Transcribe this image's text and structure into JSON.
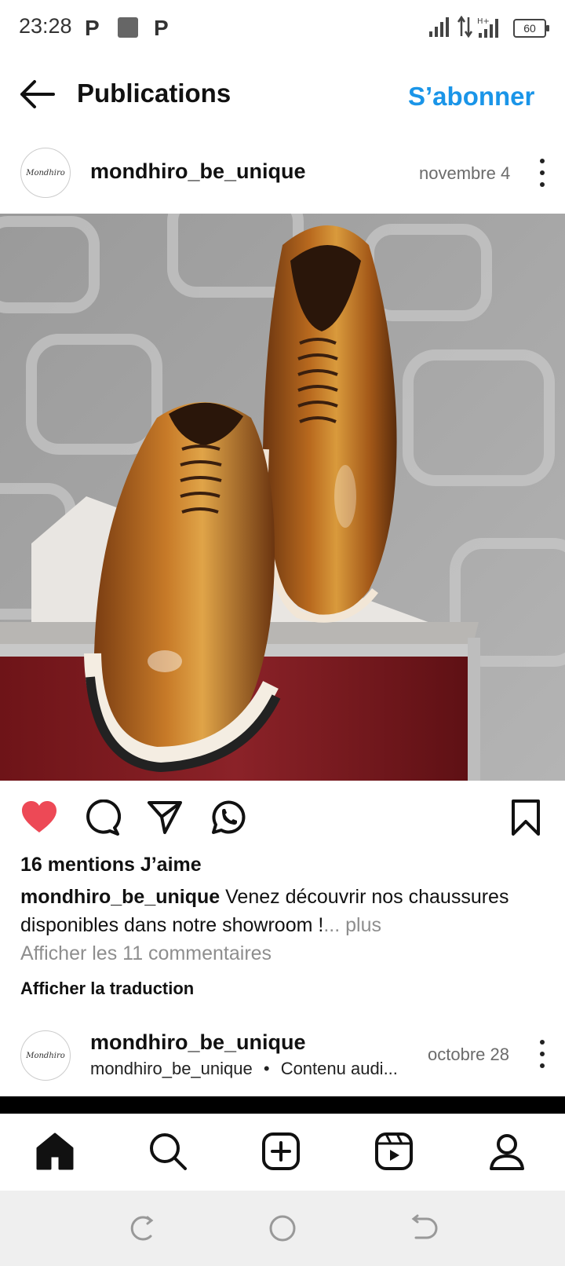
{
  "status_bar": {
    "time": "23:28",
    "battery": "60",
    "icons": [
      "p-icon",
      "photo-notification-icon",
      "p-icon",
      "signal-icon",
      "data-arrows-icon",
      "hplus-signal-icon",
      "battery-icon"
    ]
  },
  "header": {
    "title": "Publications",
    "subscribe_label": "S’abonner"
  },
  "post": {
    "username": "mondhiro_be_unique",
    "avatar_text": "Mondhiro",
    "date": "novembre 4",
    "likes": "16 mentions J’aime",
    "caption_user": "mondhiro_be_unique",
    "caption_text": " Venez découvrir nos chaussures disponibles dans notre showroom !",
    "caption_ellipsis": "...",
    "more_label": " plus",
    "comments_link": "Afficher les 11 commentaires",
    "translate_link": "Afficher la traduction",
    "liked": true
  },
  "next_post": {
    "username": "mondhiro_be_unique",
    "avatar_text": "Mondhiro",
    "subtitle_user": "mondhiro_be_unique",
    "subtitle_sep": "•",
    "subtitle_text": "Contenu audi...",
    "date": "octobre 28"
  },
  "nav": [
    "home-icon",
    "search-icon",
    "create-icon",
    "reels-icon",
    "profile-icon"
  ],
  "colors": {
    "accent": "#1a95e8",
    "like": "#ed4956",
    "secondary_text": "#8e8e8e"
  }
}
